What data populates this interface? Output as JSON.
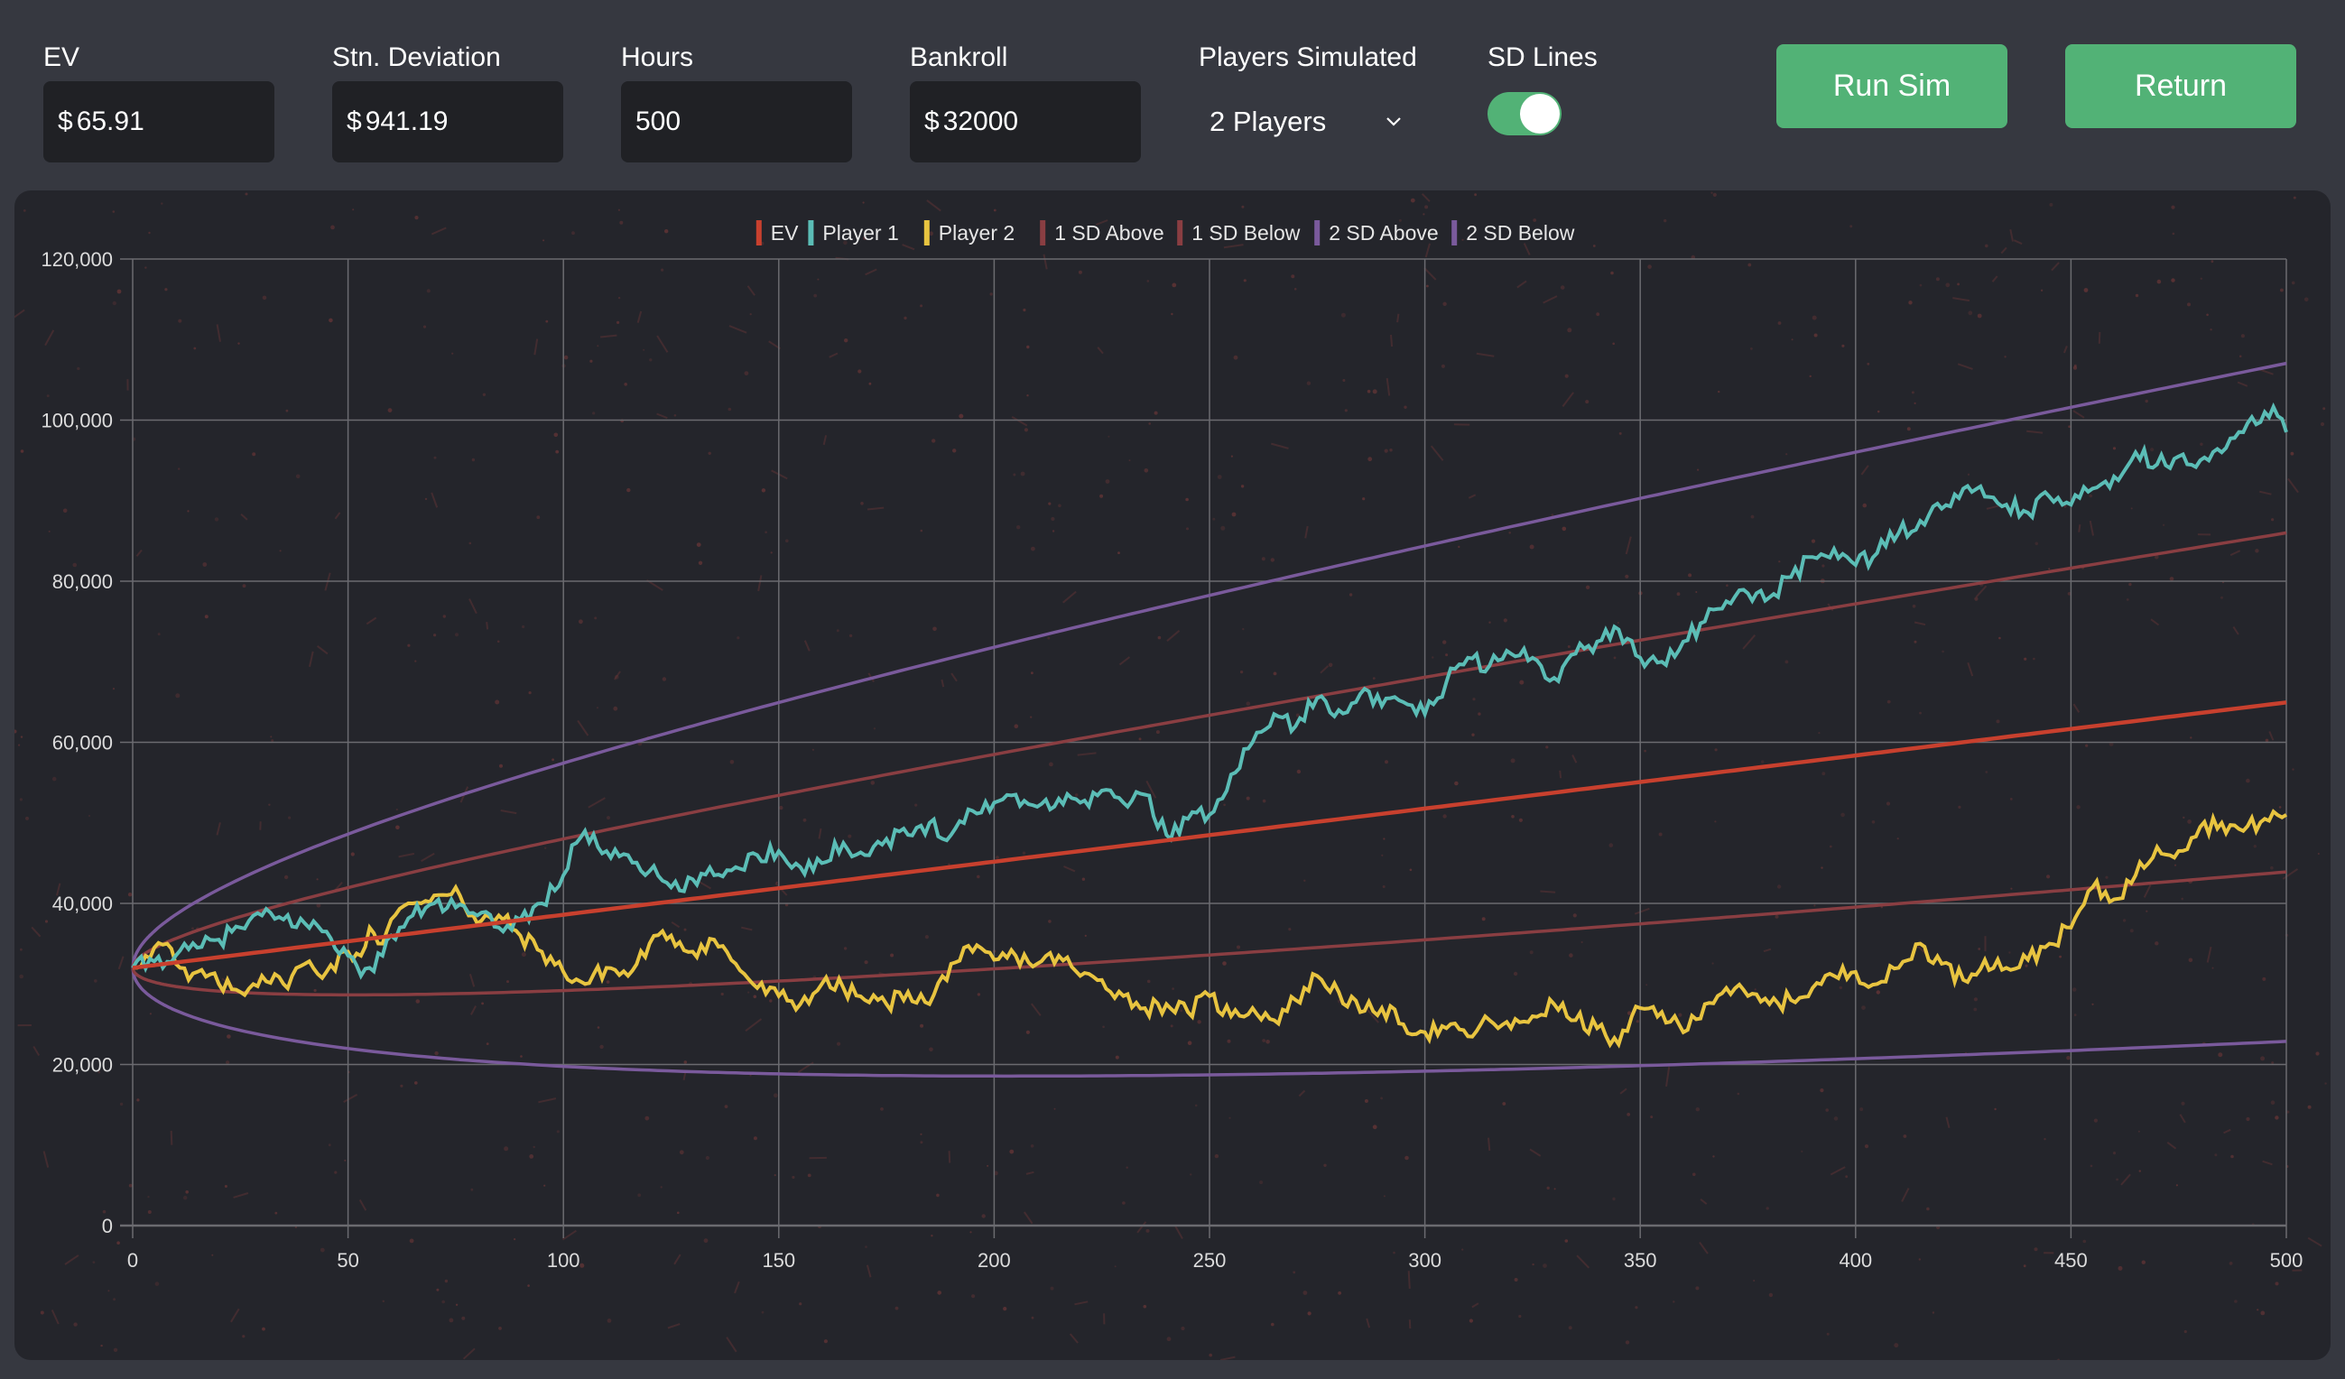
{
  "controls": {
    "ev": {
      "label": "EV",
      "prefix": "$",
      "value": "65.91"
    },
    "sd": {
      "label": "Stn. Deviation",
      "prefix": "$",
      "value": "941.19"
    },
    "hours": {
      "label": "Hours",
      "value": "500"
    },
    "bankroll": {
      "label": "Bankroll",
      "prefix": "$",
      "value": "32000"
    },
    "players": {
      "label": "Players Simulated",
      "selected": "2 Players"
    },
    "sd_lines": {
      "label": "SD Lines",
      "on": true
    },
    "run_label": "Run Sim",
    "return_label": "Return"
  },
  "colors": {
    "accent": "#52b276",
    "ev": "#c8402e",
    "player1": "#5bbdb6",
    "player2": "#e8c440",
    "sd1": "#8a3e42",
    "sd2": "#7a5a9c",
    "grid": "#6b6b70",
    "tick_text": "#dcdcdc"
  },
  "chart_data": {
    "type": "line",
    "title": "",
    "xlabel": "",
    "ylabel": "",
    "xlim": [
      0,
      500
    ],
    "ylim": [
      0,
      120000
    ],
    "x_ticks": [
      0,
      50,
      100,
      150,
      200,
      250,
      300,
      350,
      400,
      450,
      500
    ],
    "y_ticks": [
      0,
      20000,
      40000,
      60000,
      80000,
      100000,
      120000
    ],
    "y_tick_labels": [
      "0",
      "20,000",
      "40,000",
      "60,000",
      "80,000",
      "100,000",
      "120,000"
    ],
    "grid": true,
    "legend_position": "top-center",
    "legend": [
      "EV",
      "Player 1",
      "Player 2",
      "1 SD Above",
      "1 SD Below",
      "2 SD Above",
      "2 SD Below"
    ],
    "model": {
      "start": 32000,
      "ev_per_hour": 65.91,
      "sd_per_hour": 941.19,
      "hours": 500
    },
    "series": [
      {
        "name": "EV",
        "formula": "start + ev*h",
        "values_at_ticks": [
          32000,
          35296,
          38591,
          41887,
          45182,
          48478,
          51773,
          55069,
          58364,
          61660,
          64955
        ]
      },
      {
        "name": "1 SD Above",
        "formula": "start + ev*h + sd*sqrt(h)",
        "values_at_ticks": [
          32000,
          41951,
          48003,
          53414,
          58492,
          63359,
          68075,
          72677,
          77189,
          81628,
          86001
        ]
      },
      {
        "name": "1 SD Below",
        "formula": "start + ev*h - sd*sqrt(h)",
        "values_at_ticks": [
          32000,
          28641,
          29179,
          30360,
          31872,
          33597,
          35471,
          37461,
          39539,
          41692,
          43909
        ]
      },
      {
        "name": "2 SD Above",
        "formula": "start + ev*h + 2*sd*sqrt(h)",
        "values_at_ticks": [
          32000,
          48606,
          57415,
          64941,
          71802,
          78240,
          84377,
          90285,
          96014,
          101596,
          107047
        ]
      },
      {
        "name": "2 SD Below",
        "formula": "start + ev*h - 2*sd*sqrt(h)",
        "values_at_ticks": [
          32000,
          21985,
          19767,
          18833,
          18562,
          18716,
          19169,
          19853,
          20714,
          21724,
          22863
        ]
      },
      {
        "name": "Player 1",
        "x": [
          0,
          5,
          10,
          15,
          20,
          25,
          30,
          35,
          40,
          45,
          50,
          53,
          55,
          58,
          60,
          65,
          70,
          75,
          80,
          85,
          90,
          95,
          100,
          103,
          105,
          108,
          110,
          115,
          120,
          125,
          128,
          130,
          135,
          140,
          145,
          150,
          155,
          160,
          165,
          170,
          175,
          180,
          185,
          190,
          195,
          200,
          205,
          210,
          215,
          220,
          225,
          230,
          235,
          240,
          245,
          250,
          255,
          260,
          265,
          270,
          275,
          280,
          285,
          290,
          295,
          300,
          305,
          310,
          315,
          320,
          325,
          330,
          335,
          340,
          345,
          350,
          355,
          360,
          365,
          370,
          375,
          380,
          385,
          390,
          395,
          400,
          405,
          410,
          415,
          420,
          425,
          430,
          435,
          440,
          445,
          450,
          455,
          460,
          465,
          470,
          475,
          480,
          485,
          490,
          495,
          498,
          500
        ],
        "values": [
          32000,
          32800,
          33500,
          34500,
          35500,
          37000,
          38500,
          38000,
          37500,
          36500,
          33500,
          31000,
          32000,
          33500,
          36000,
          38500,
          40000,
          39500,
          38500,
          37000,
          38000,
          40000,
          43500,
          47500,
          49000,
          47000,
          46500,
          46000,
          44000,
          42000,
          41500,
          43000,
          43500,
          44500,
          46000,
          46500,
          44500,
          45000,
          47500,
          46000,
          48000,
          48500,
          50000,
          48500,
          51500,
          52500,
          53500,
          52000,
          53000,
          52500,
          54000,
          52500,
          53500,
          48500,
          50500,
          51000,
          56000,
          60000,
          63500,
          62000,
          65500,
          64000,
          66000,
          64500,
          65000,
          63500,
          67500,
          70500,
          69500,
          71000,
          70500,
          68000,
          71000,
          72500,
          74000,
          70500,
          70000,
          72500,
          75000,
          77500,
          78500,
          78000,
          80500,
          83000,
          84000,
          82000,
          83500,
          86000,
          87500,
          89000,
          91500,
          90500,
          89500,
          88500,
          90500,
          89500,
          91500,
          93000,
          96000,
          94500,
          95500,
          95000,
          96000,
          98500,
          101000,
          100500,
          98500
        ]
      },
      {
        "name": "Player 2",
        "x": [
          0,
          3,
          5,
          8,
          10,
          13,
          15,
          20,
          25,
          30,
          35,
          40,
          45,
          50,
          53,
          55,
          58,
          60,
          65,
          70,
          75,
          78,
          80,
          85,
          90,
          95,
          100,
          105,
          110,
          115,
          120,
          125,
          130,
          135,
          140,
          145,
          150,
          155,
          160,
          165,
          170,
          175,
          180,
          185,
          190,
          195,
          200,
          205,
          210,
          215,
          220,
          225,
          230,
          235,
          240,
          245,
          250,
          255,
          260,
          265,
          270,
          275,
          280,
          285,
          290,
          295,
          300,
          305,
          310,
          315,
          320,
          325,
          330,
          335,
          340,
          345,
          350,
          355,
          360,
          365,
          370,
          375,
          380,
          385,
          390,
          395,
          400,
          405,
          410,
          415,
          420,
          425,
          430,
          435,
          440,
          445,
          450,
          455,
          460,
          465,
          470,
          475,
          480,
          485,
          490,
          495,
          500
        ],
        "values": [
          32000,
          33500,
          34500,
          35000,
          32500,
          30500,
          31500,
          30000,
          29000,
          31000,
          30000,
          32500,
          31500,
          34000,
          33500,
          37000,
          35000,
          38000,
          40000,
          41000,
          42000,
          38500,
          37500,
          38500,
          36000,
          34000,
          31500,
          30000,
          32000,
          31000,
          35000,
          36000,
          34000,
          35500,
          32500,
          29500,
          28500,
          27500,
          30000,
          29500,
          28000,
          27500,
          29000,
          27500,
          32500,
          34000,
          33000,
          33500,
          32500,
          33500,
          31000,
          30500,
          28500,
          27000,
          27500,
          26500,
          28500,
          26000,
          27000,
          25500,
          28000,
          31000,
          29000,
          26500,
          27000,
          25000,
          24000,
          24500,
          23500,
          25500,
          24500,
          26000,
          27500,
          25500,
          24500,
          22500,
          27000,
          26500,
          24000,
          27500,
          29500,
          28500,
          27500,
          28000,
          29500,
          31000,
          31500,
          30000,
          32000,
          35000,
          32500,
          30500,
          33000,
          32000,
          33000,
          35000,
          37000,
          42000,
          40500,
          43500,
          47000,
          46500,
          49500,
          50000,
          49000,
          50500,
          51000
        ]
      }
    ]
  }
}
